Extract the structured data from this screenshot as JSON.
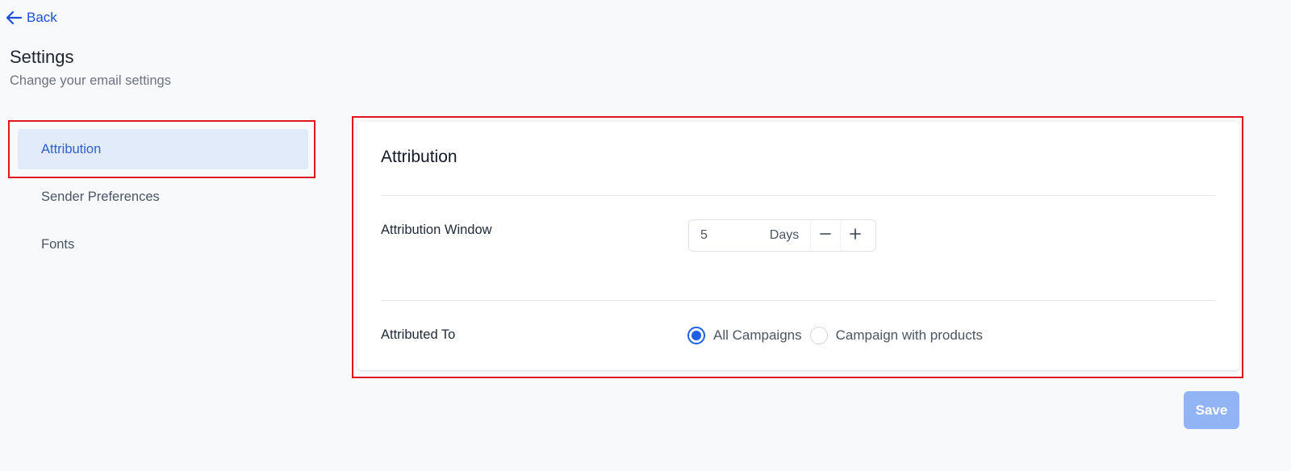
{
  "header": {
    "back_label": "Back",
    "title": "Settings",
    "subtitle": "Change your email settings"
  },
  "sidebar": {
    "items": [
      {
        "label": "Attribution",
        "active": true
      },
      {
        "label": "Sender Preferences",
        "active": false
      },
      {
        "label": "Fonts",
        "active": false
      }
    ]
  },
  "attribution": {
    "title": "Attribution",
    "window_label": "Attribution Window",
    "window_value": "5",
    "window_unit": "Days",
    "attributed_to_label": "Attributed To",
    "options": [
      {
        "label": "All Campaigns",
        "checked": true
      },
      {
        "label": "Campaign with products",
        "checked": false
      }
    ]
  },
  "footer": {
    "save_label": "Save"
  },
  "colors": {
    "accent": "#1d5fe6",
    "active_bg": "#e1ebfa",
    "highlight": "#e0161e",
    "save_disabled": "#93b4f4"
  },
  "icons": {
    "back": "arrow-left-icon",
    "decrement": "minus-icon",
    "increment": "plus-icon"
  }
}
